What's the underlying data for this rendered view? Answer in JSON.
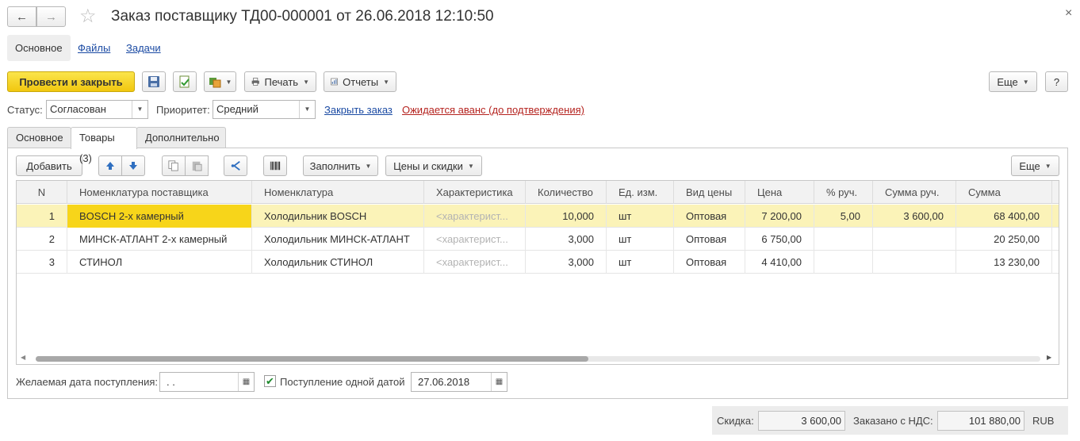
{
  "window": {
    "title": "Заказ поставщику ТД00-000001 от 26.06.2018 12:10:50",
    "back_glyph": "←",
    "forward_glyph": "→",
    "star_glyph": "☆",
    "close_glyph": "×"
  },
  "sections": {
    "main": "Основное",
    "files": "Файлы",
    "tasks": "Задачи"
  },
  "toolbar": {
    "post_close": "Провести и закрыть",
    "print": "Печать",
    "reports": "Отчеты",
    "more": "Еще",
    "help": "?",
    "icons": [
      "save-icon",
      "post-icon",
      "create-based-on-icon",
      "printer-icon",
      "reports-icon"
    ]
  },
  "status_row": {
    "status_label": "Статус:",
    "status_value": "Согласован",
    "priority_label": "Приоритет:",
    "priority_value": "Средний",
    "close_order_link": "Закрыть заказ",
    "advance_link": "Ожидается аванс (до подтверждения)"
  },
  "tabs": {
    "main": "Основное",
    "goods": "Товары (3)",
    "extra": "Дополнительно"
  },
  "grid_toolbar": {
    "add": "Добавить",
    "fill": "Заполнить",
    "prices": "Цены и скидки",
    "more": "Еще"
  },
  "grid": {
    "headers": [
      "N",
      "Номенклатура поставщика",
      "Номенклатура",
      "Характеристика",
      "Количество",
      "Ед. изм.",
      "Вид цены",
      "Цена",
      "% руч.",
      "Сумма руч.",
      "Сумма"
    ],
    "rows": [
      {
        "n": "1",
        "supplier_item": "BOSCH 2-х камерный",
        "item": "Холодильник BOSCH",
        "characteristic": "<характерист...",
        "qty": "10,000",
        "unit": "шт",
        "price_type": "Оптовая",
        "price": "7 200,00",
        "manual_pct": "5,00",
        "manual_sum": "3 600,00",
        "sum": "68 400,00"
      },
      {
        "n": "2",
        "supplier_item": "МИНСК-АТЛАНТ 2-х камерный",
        "item": "Холодильник МИНСК-АТЛАНТ",
        "characteristic": "<характерист...",
        "qty": "3,000",
        "unit": "шт",
        "price_type": "Оптовая",
        "price": "6 750,00",
        "manual_pct": "",
        "manual_sum": "",
        "sum": "20 250,00"
      },
      {
        "n": "3",
        "supplier_item": "СТИНОЛ",
        "item": "Холодильник СТИНОЛ",
        "characteristic": "<характерист...",
        "qty": "3,000",
        "unit": "шт",
        "price_type": "Оптовая",
        "price": "4 410,00",
        "manual_pct": "",
        "manual_sum": "",
        "sum": "13 230,00"
      }
    ],
    "scroll_fraction": 0.55
  },
  "bottom": {
    "desired_date_label": "Желаемая дата поступления:",
    "desired_date_value": " .  .",
    "single_date_label": "Поступление одной датой",
    "single_date_checked": true,
    "single_date_value": "27.06.2018"
  },
  "footer": {
    "discount_label": "Скидка:",
    "discount_value": "3 600,00",
    "ordered_label": "Заказано с НДС:",
    "ordered_value": "101 880,00",
    "currency": "RUB"
  },
  "colors": {
    "primary_button": "#f5d126",
    "selected_row": "#fbf3b8",
    "focused_cell": "#f7d51a",
    "link_blue": "#1a4aa3",
    "link_red": "#b5231f"
  }
}
